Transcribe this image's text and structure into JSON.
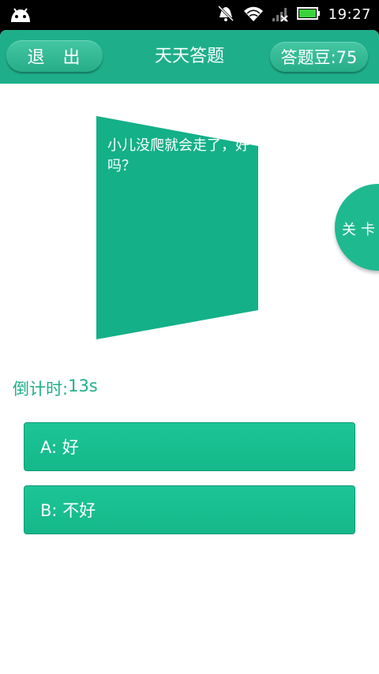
{
  "status_bar": {
    "time": "19:27",
    "icons": [
      "android-icon",
      "mute-icon",
      "wifi-icon",
      "signal-icon",
      "battery-icon"
    ]
  },
  "header": {
    "exit_label": "退 出",
    "title": "天天答题",
    "beans_label": "答题豆:75"
  },
  "question": {
    "text": "小儿没爬就会走了，好吗？"
  },
  "level_button": {
    "label": "关卡"
  },
  "countdown": {
    "label": "倒计时:",
    "value": "13s"
  },
  "answers": [
    {
      "label": "A: 好"
    },
    {
      "label": "B: 不好"
    }
  ],
  "colors": {
    "primary": "#1eaf8a",
    "accent": "#15b88a",
    "background": "#ffffff"
  }
}
